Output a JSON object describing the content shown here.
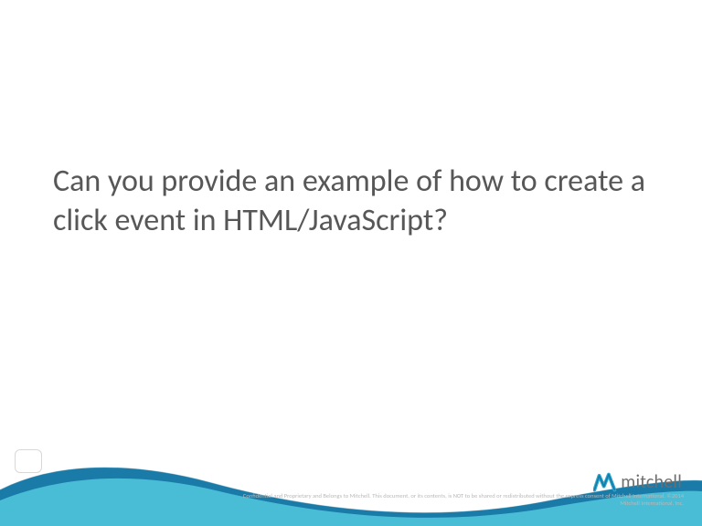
{
  "slide": {
    "title": "Can you provide an example of how to create a click event in HTML/JavaScript?"
  },
  "logo": {
    "text": "mitchell"
  },
  "footer": {
    "confidential": "Confidential and Proprietary and Belongs to Mitchell. This document, or its contents, is NOT to be shared or redistributed without the express consent of Mitchell International. ©2014 Mitchell International, Inc."
  },
  "colors": {
    "wave_outer": "#1a7aa8",
    "wave_inner": "#49bcd6",
    "logo_accent": "#2aa9cf",
    "text_gray": "#575757"
  }
}
